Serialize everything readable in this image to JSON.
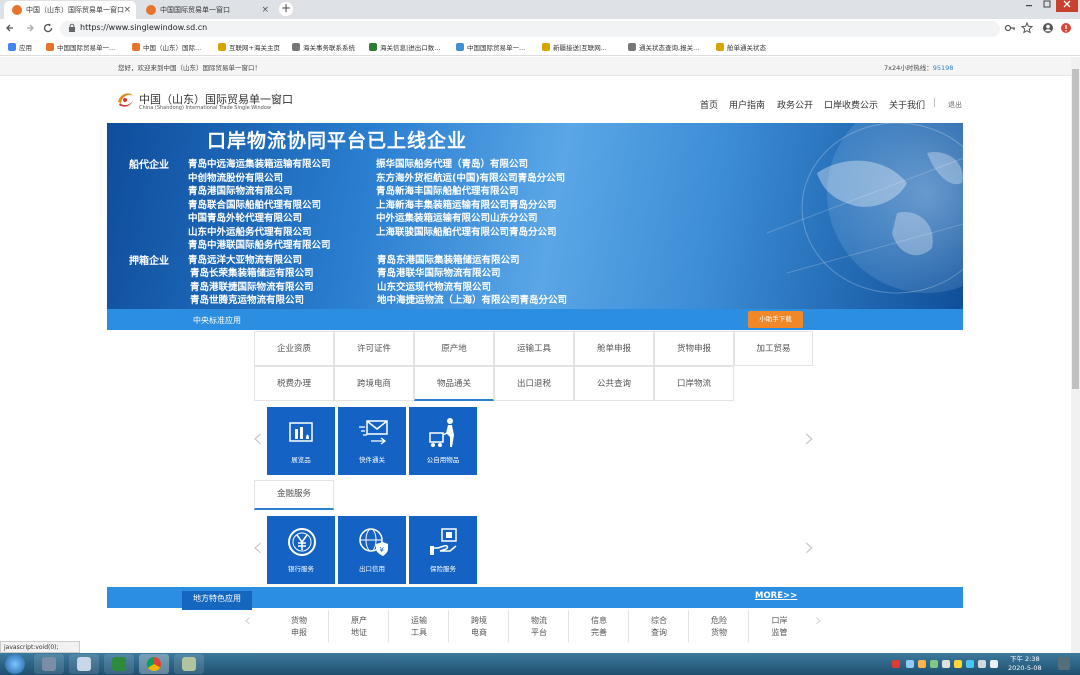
{
  "browser": {
    "tabs": [
      {
        "label": "中国（山东）国际贸易单一窗口"
      },
      {
        "label": "中国国际贸易单一窗口"
      }
    ],
    "close_glyph": "×",
    "new_tab_glyph": "+",
    "url": "https://www.singlewindow.sd.cn",
    "bookmarks": [
      {
        "label": "应用",
        "icon": "apps-grid-icon",
        "color": "#4285f4"
      },
      {
        "label": "中国国际贸易单一...",
        "icon": "site-favicon",
        "color": "#e8742b"
      },
      {
        "label": "中国（山东）国际...",
        "icon": "site-favicon",
        "color": "#e8742b"
      },
      {
        "label": "互联网+海关主页",
        "icon": "customs-favicon",
        "color": "#d9a400"
      },
      {
        "label": "海关事务联系系统",
        "icon": "page-icon",
        "color": "#777777"
      },
      {
        "label": "海关信息|进出口数...",
        "icon": "globe-favicon",
        "color": "#2e7d32"
      },
      {
        "label": "中国国际贸易单一...",
        "icon": "pin-favicon",
        "color": "#3f8fd2"
      },
      {
        "label": "新疆接送|互联网...",
        "icon": "customs-favicon",
        "color": "#d9a400"
      },
      {
        "label": "通关状态查询,报关...",
        "icon": "page-icon",
        "color": "#777777"
      },
      {
        "label": "舱单通关状态",
        "icon": "customs-favicon",
        "color": "#d9a400"
      }
    ],
    "status_url": "javascript:void(0);"
  },
  "topbar": {
    "welcome": "您好，欢迎来到中国（山东）国际贸易单一窗口！",
    "hotline_label": "7x24小时热线：",
    "hotline_number": "95198"
  },
  "header": {
    "logo_cn": "中国（山东）国际贸易单一窗口",
    "logo_en": "China (Shandong) International Trade Single Window",
    "nav": [
      "首页",
      "用户指南",
      "政务公开",
      "口岸收费公示",
      "关于我们"
    ],
    "separator": "|",
    "logout": "退出"
  },
  "banner": {
    "title": "口岸物流协同平台已上线企业",
    "categories": [
      {
        "label": "船代企业",
        "companies": [
          "青岛中远海运集装箱运输有限公司",
          "中创物流股份有限公司",
          "青岛港国际物流有限公司",
          "青岛联合国际船舶代理有限公司",
          "中国青岛外轮代理有限公司",
          "山东中外运船务代理有限公司",
          "青岛中港联国际船务代理有限公司",
          "振华国际船务代理（青岛）有限公司",
          "东方海外货柜航运(中国)有限公司青岛分公司",
          "青岛新海丰国际船舶代理有限公司",
          "上海新海丰集装箱运输有限公司青岛分公司",
          "中外运集装箱运输有限公司山东分公司",
          "上海联骏国际船舶代理有限公司青岛分公司"
        ]
      },
      {
        "label": "押箱企业",
        "companies": [
          "青岛远洋大亚物流有限公司",
          "青岛长荣集装箱储运有限公司",
          "青岛港联捷国际物流有限公司",
          "青岛世腾克运物流有限公司",
          "青岛东港国际集装箱储运有限公司",
          "青岛港联华国际物流有限公司",
          "山东交运现代物流有限公司",
          "地中海捷运物流（上海）有限公司青岛分公司"
        ]
      }
    ]
  },
  "central": {
    "label": "中央标准应用",
    "helper_button": "小助手下载",
    "tabs_row1": [
      "企业资质",
      "许可证件",
      "原产地",
      "运输工具",
      "舱单申报",
      "货物申报",
      "加工贸易"
    ],
    "tabs_row2": [
      "税费办理",
      "跨境电商",
      "物品通关",
      "出口退税",
      "公共查询",
      "口岸物流"
    ],
    "active_tab": "物品通关",
    "tiles": [
      {
        "label": "展览品",
        "icon": "exhibit-icon"
      },
      {
        "label": "快件通关",
        "icon": "express-envelope-icon"
      },
      {
        "label": "公自用物品",
        "icon": "person-cart-icon"
      }
    ],
    "finance_tab": "金融服务",
    "finance_tiles": [
      {
        "label": "银行服务",
        "icon": "yuan-coin-icon"
      },
      {
        "label": "出口信用",
        "icon": "globe-shield-icon"
      },
      {
        "label": "保险服务",
        "icon": "hand-card-icon"
      }
    ]
  },
  "local": {
    "label": "地方特色应用",
    "more": "MORE>>",
    "items": [
      [
        "货物",
        "申报"
      ],
      [
        "原产",
        "地证"
      ],
      [
        "运输",
        "工具"
      ],
      [
        "跨境",
        "电商"
      ],
      [
        "物流",
        "平台"
      ],
      [
        "信息",
        "完善"
      ],
      [
        "综合",
        "查询"
      ],
      [
        "危险",
        "货物"
      ],
      [
        "口岸",
        "监管"
      ]
    ]
  },
  "arrows": {
    "left": "‹",
    "right": "›"
  },
  "taskbar": {
    "time": "下午 2:38",
    "date": "2020-5-08"
  }
}
